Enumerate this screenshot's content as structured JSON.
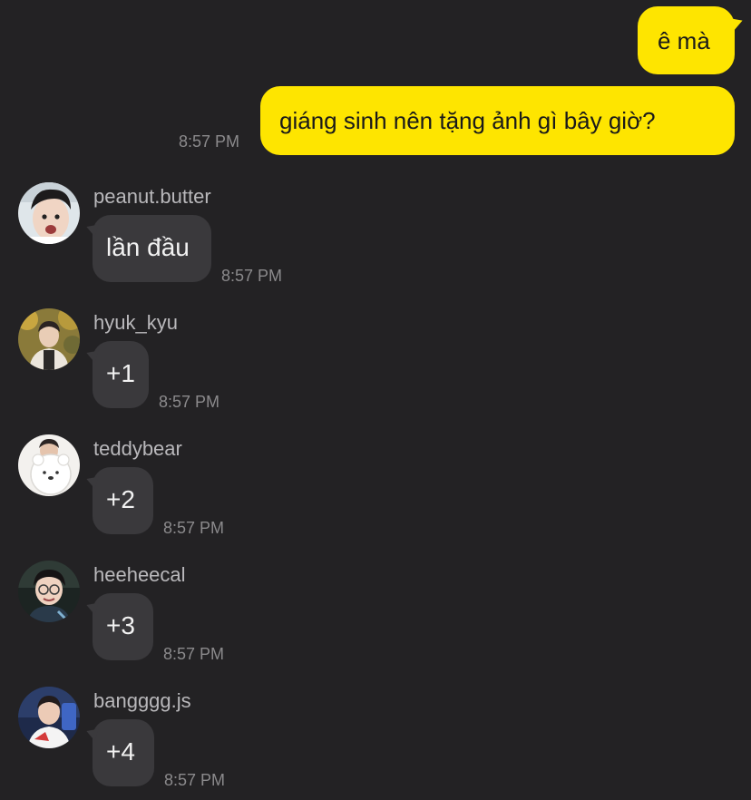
{
  "outgoing": [
    {
      "text": "ê mà"
    },
    {
      "text": "giáng sinh nên tặng ảnh gì bây giờ?",
      "time": "8:57 PM"
    }
  ],
  "incoming": [
    {
      "sender": "peanut.butter",
      "text": "lần đầu",
      "time": "8:57 PM",
      "avatar": "avatar-peanut-butter"
    },
    {
      "sender": "hyuk_kyu",
      "text": "+1",
      "time": "8:57 PM",
      "avatar": "avatar-hyuk-kyu"
    },
    {
      "sender": "teddybear",
      "text": "+2",
      "time": "8:57 PM",
      "avatar": "avatar-teddybear"
    },
    {
      "sender": "heeheecal",
      "text": "+3",
      "time": "8:57 PM",
      "avatar": "avatar-heeheecal"
    },
    {
      "sender": "bangggg.js",
      "text": "+4",
      "time": "8:57 PM",
      "avatar": "avatar-bangggg-js"
    }
  ],
  "colors": {
    "background": "#232224",
    "outgoing_bubble": "#fee500",
    "incoming_bubble": "#3a393c",
    "timestamp": "#8b8a8c",
    "sender_name": "#b9b8bb"
  }
}
